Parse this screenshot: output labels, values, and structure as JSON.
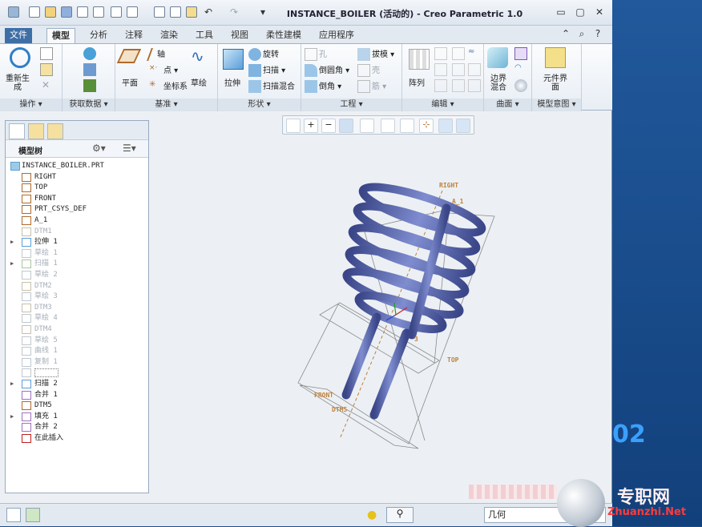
{
  "window": {
    "title": "INSTANCE_BOILER (活动的) - Creo Parametric 1.0"
  },
  "tabs": [
    {
      "label": "文件"
    },
    {
      "label": "模型"
    },
    {
      "label": "分析"
    },
    {
      "label": "注释"
    },
    {
      "label": "渲染"
    },
    {
      "label": "工具"
    },
    {
      "label": "视图"
    },
    {
      "label": "柔性建模"
    },
    {
      "label": "应用程序"
    }
  ],
  "ribbon": {
    "groups": [
      {
        "label": "操作"
      },
      {
        "label": "获取数据"
      },
      {
        "label": "基准"
      },
      {
        "label": "形状"
      },
      {
        "label": "工程"
      },
      {
        "label": "编辑"
      },
      {
        "label": "曲面"
      },
      {
        "label": "模型意图"
      }
    ],
    "regen": "重新生成",
    "plane": "平面",
    "axis": "轴",
    "point": "点",
    "csys": "坐标系",
    "sketch": "草绘",
    "extrude": "拉伸",
    "revolve": "旋转",
    "sweep": "扫描",
    "sweep_blend": "扫描混合",
    "hole": "孔",
    "round": "倒圆角",
    "chamfer": "倒角",
    "draft": "拔模",
    "shell": "壳",
    "rib": "筋",
    "pattern": "阵列",
    "boundary_blend": "边界混合",
    "component_interface": "元件界面"
  },
  "navigator": {
    "tree_title": "模型树",
    "items": [
      {
        "label": "INSTANCE_BOILER.PRT",
        "dim": false,
        "expand": ""
      },
      {
        "label": "RIGHT",
        "dim": false,
        "expand": ""
      },
      {
        "label": "TOP",
        "dim": false,
        "expand": ""
      },
      {
        "label": "FRONT",
        "dim": false,
        "expand": ""
      },
      {
        "label": "PRT_CSYS_DEF",
        "dim": false,
        "expand": ""
      },
      {
        "label": "A_1",
        "dim": false,
        "expand": ""
      },
      {
        "label": "DTM1",
        "dim": true,
        "expand": ""
      },
      {
        "label": "拉伸 1",
        "dim": false,
        "expand": "▶"
      },
      {
        "label": "草绘 1",
        "dim": true,
        "expand": ""
      },
      {
        "label": "扫描 1",
        "dim": true,
        "expand": "▶"
      },
      {
        "label": "草绘 2",
        "dim": true,
        "expand": ""
      },
      {
        "label": "DTM2",
        "dim": true,
        "expand": ""
      },
      {
        "label": "草绘 3",
        "dim": true,
        "expand": ""
      },
      {
        "label": "DTM3",
        "dim": true,
        "expand": ""
      },
      {
        "label": "草绘 4",
        "dim": true,
        "expand": ""
      },
      {
        "label": "DTM4",
        "dim": true,
        "expand": ""
      },
      {
        "label": "草绘 5",
        "dim": true,
        "expand": ""
      },
      {
        "label": "曲线 1",
        "dim": true,
        "expand": ""
      },
      {
        "label": "复制 1",
        "dim": true,
        "expand": ""
      },
      {
        "label": "",
        "dim": true,
        "expand": ""
      },
      {
        "label": "扫描 2",
        "dim": false,
        "expand": "▶"
      },
      {
        "label": "合并 1",
        "dim": false,
        "expand": ""
      },
      {
        "label": "DTM5",
        "dim": false,
        "expand": ""
      },
      {
        "label": "填充 1",
        "dim": false,
        "expand": "▶"
      },
      {
        "label": "合并 2",
        "dim": false,
        "expand": ""
      },
      {
        "label": "在此插入",
        "dim": false,
        "expand": ""
      }
    ]
  },
  "viewport": {
    "datum_labels": {
      "right": "RIGHT",
      "a1": "A_1",
      "top": "TOP",
      "front": "FRONT",
      "dtm5": "DTM5",
      "a3": "3"
    }
  },
  "status": {
    "filter_value": "几何"
  },
  "watermark": {
    "number": "02",
    "cn": "专职网",
    "url": "Zhuanzhi.Net"
  },
  "colors": {
    "pipe": "#4f5ea8",
    "datum": "#c0803a",
    "accent": "#3e6ea6"
  }
}
